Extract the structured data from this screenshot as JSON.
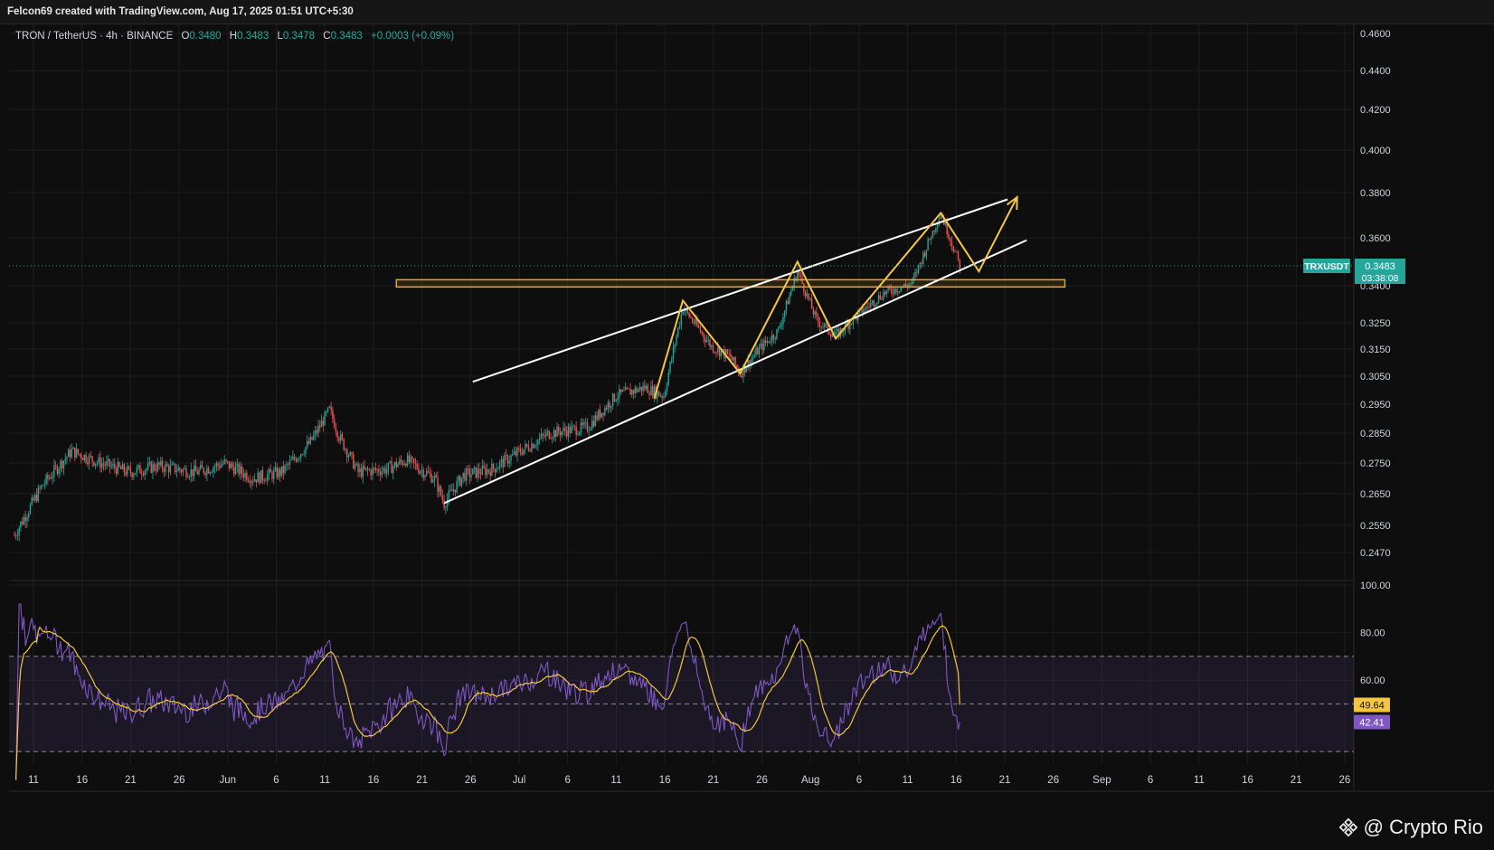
{
  "header": {
    "credit": "Felcon69 created with TradingView.com, Aug 17, 2025 01:51 UTC+5:30"
  },
  "legend": {
    "symbol": "TRON / TetherUS · 4h · BINANCE",
    "o_label": "O",
    "o": "0.3480",
    "h_label": "H",
    "h": "0.3483",
    "l_label": "L",
    "l": "0.3478",
    "c_label": "C",
    "c": "0.3483",
    "change": "+0.0003 (+0.09%)"
  },
  "price_tag": {
    "symbol": "TRXUSDT",
    "price": "0.3483",
    "countdown": "03:38:08"
  },
  "rsi_tags": {
    "ma": "49.64",
    "rsi": "42.41"
  },
  "watermark": {
    "text": "@ Crypto Rio"
  },
  "colors": {
    "up": "#26a69a",
    "down": "#ef5350",
    "rsi": "#7e57c2",
    "rsi_ma": "#f5c542",
    "pattern": "#f5c542",
    "channel": "#ffffff",
    "zone": "#f0a030"
  },
  "chart_data": {
    "type": "candlestick",
    "price_axis_labels": [
      "0.4600",
      "0.4400",
      "0.4200",
      "0.4000",
      "0.3800",
      "0.3600",
      "0.3400",
      "0.3250",
      "0.3150",
      "0.3050",
      "0.2950",
      "0.2850",
      "0.2750",
      "0.2650",
      "0.2550",
      "0.2470"
    ],
    "rsi_axis_labels": [
      "100.00",
      "80.00",
      "60.00"
    ],
    "rsi_bands": [
      70,
      50,
      30
    ],
    "x_tick_labels": [
      "11",
      "16",
      "21",
      "26",
      "Jun",
      "6",
      "11",
      "16",
      "21",
      "26",
      "Jul",
      "6",
      "11",
      "16",
      "21",
      "26",
      "Aug",
      "6",
      "11",
      "16",
      "21",
      "26",
      "Sep",
      "6",
      "11",
      "16",
      "21",
      "26"
    ],
    "close_path": [
      [
        "May 9",
        0.252
      ],
      [
        "May 12",
        0.268
      ],
      [
        "May 15",
        0.279
      ],
      [
        "May 18",
        0.275
      ],
      [
        "May 21",
        0.272
      ],
      [
        "May 24",
        0.274
      ],
      [
        "May 28",
        0.272
      ],
      [
        "May 31",
        0.275
      ],
      [
        "Jun 3",
        0.27
      ],
      [
        "Jun 6",
        0.272
      ],
      [
        "Jun 9",
        0.282
      ],
      [
        "Jun 11",
        0.293
      ],
      [
        "Jun 12",
        0.284
      ],
      [
        "Jun 14",
        0.272
      ],
      [
        "Jun 17",
        0.273
      ],
      [
        "Jun 19",
        0.276
      ],
      [
        "Jun 22",
        0.27
      ],
      [
        "Jun 23",
        0.262
      ],
      [
        "Jun 25",
        0.271
      ],
      [
        "Jun 28",
        0.273
      ],
      [
        "Jul 1",
        0.279
      ],
      [
        "Jul 4",
        0.285
      ],
      [
        "Jul 8",
        0.287
      ],
      [
        "Jul 11",
        0.298
      ],
      [
        "Jul 14",
        0.301
      ],
      [
        "Jul 16",
        0.298
      ],
      [
        "Jul 18",
        0.331
      ],
      [
        "Jul 21",
        0.316
      ],
      [
        "Jul 23",
        0.312
      ],
      [
        "Jul 24",
        0.306
      ],
      [
        "Jul 26",
        0.315
      ],
      [
        "Jul 28",
        0.322
      ],
      [
        "Jul 30",
        0.346
      ],
      [
        "Aug 1",
        0.326
      ],
      [
        "Aug 3",
        0.32
      ],
      [
        "Aug 5",
        0.327
      ],
      [
        "Aug 8",
        0.337
      ],
      [
        "Aug 11",
        0.341
      ],
      [
        "Aug 14",
        0.371
      ],
      [
        "Aug 16",
        0.3483
      ]
    ],
    "rsi": {
      "name": "RSI",
      "last": 42.41
    },
    "rsi_ma": {
      "name": "MA",
      "last": 49.64
    },
    "annotations": {
      "channel_upper": [
        [
          "Jun 26",
          0.303
        ],
        [
          "Aug 21",
          0.377
        ]
      ],
      "channel_lower": [
        [
          "Jun 23",
          0.262
        ],
        [
          "Aug 23",
          0.359
        ]
      ],
      "resistance_zone": {
        "from": "Jun 18",
        "to": "Aug 27",
        "low": 0.3395,
        "high": 0.3425
      },
      "zigzag": [
        [
          "Jul 15",
          0.297
        ],
        [
          "Jul 18",
          0.334
        ],
        [
          "Jul 24",
          0.306
        ],
        [
          "Jul 30",
          0.35
        ],
        [
          "Aug 3",
          0.319
        ],
        [
          "Aug 14",
          0.371
        ],
        [
          "Aug 18",
          0.346
        ],
        [
          "Aug 22",
          0.378
        ]
      ]
    }
  }
}
